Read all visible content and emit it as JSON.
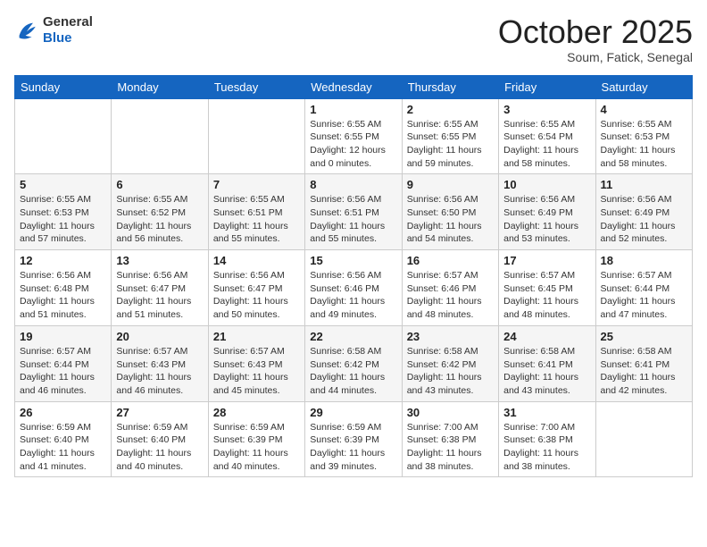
{
  "header": {
    "logo_general": "General",
    "logo_blue": "Blue",
    "month_title": "October 2025",
    "location": "Soum, Fatick, Senegal"
  },
  "columns": [
    "Sunday",
    "Monday",
    "Tuesday",
    "Wednesday",
    "Thursday",
    "Friday",
    "Saturday"
  ],
  "weeks": [
    [
      {
        "day": "",
        "info": ""
      },
      {
        "day": "",
        "info": ""
      },
      {
        "day": "",
        "info": ""
      },
      {
        "day": "1",
        "info": "Sunrise: 6:55 AM\nSunset: 6:55 PM\nDaylight: 12 hours\nand 0 minutes."
      },
      {
        "day": "2",
        "info": "Sunrise: 6:55 AM\nSunset: 6:55 PM\nDaylight: 11 hours\nand 59 minutes."
      },
      {
        "day": "3",
        "info": "Sunrise: 6:55 AM\nSunset: 6:54 PM\nDaylight: 11 hours\nand 58 minutes."
      },
      {
        "day": "4",
        "info": "Sunrise: 6:55 AM\nSunset: 6:53 PM\nDaylight: 11 hours\nand 58 minutes."
      }
    ],
    [
      {
        "day": "5",
        "info": "Sunrise: 6:55 AM\nSunset: 6:53 PM\nDaylight: 11 hours\nand 57 minutes."
      },
      {
        "day": "6",
        "info": "Sunrise: 6:55 AM\nSunset: 6:52 PM\nDaylight: 11 hours\nand 56 minutes."
      },
      {
        "day": "7",
        "info": "Sunrise: 6:55 AM\nSunset: 6:51 PM\nDaylight: 11 hours\nand 55 minutes."
      },
      {
        "day": "8",
        "info": "Sunrise: 6:56 AM\nSunset: 6:51 PM\nDaylight: 11 hours\nand 55 minutes."
      },
      {
        "day": "9",
        "info": "Sunrise: 6:56 AM\nSunset: 6:50 PM\nDaylight: 11 hours\nand 54 minutes."
      },
      {
        "day": "10",
        "info": "Sunrise: 6:56 AM\nSunset: 6:49 PM\nDaylight: 11 hours\nand 53 minutes."
      },
      {
        "day": "11",
        "info": "Sunrise: 6:56 AM\nSunset: 6:49 PM\nDaylight: 11 hours\nand 52 minutes."
      }
    ],
    [
      {
        "day": "12",
        "info": "Sunrise: 6:56 AM\nSunset: 6:48 PM\nDaylight: 11 hours\nand 51 minutes."
      },
      {
        "day": "13",
        "info": "Sunrise: 6:56 AM\nSunset: 6:47 PM\nDaylight: 11 hours\nand 51 minutes."
      },
      {
        "day": "14",
        "info": "Sunrise: 6:56 AM\nSunset: 6:47 PM\nDaylight: 11 hours\nand 50 minutes."
      },
      {
        "day": "15",
        "info": "Sunrise: 6:56 AM\nSunset: 6:46 PM\nDaylight: 11 hours\nand 49 minutes."
      },
      {
        "day": "16",
        "info": "Sunrise: 6:57 AM\nSunset: 6:46 PM\nDaylight: 11 hours\nand 48 minutes."
      },
      {
        "day": "17",
        "info": "Sunrise: 6:57 AM\nSunset: 6:45 PM\nDaylight: 11 hours\nand 48 minutes."
      },
      {
        "day": "18",
        "info": "Sunrise: 6:57 AM\nSunset: 6:44 PM\nDaylight: 11 hours\nand 47 minutes."
      }
    ],
    [
      {
        "day": "19",
        "info": "Sunrise: 6:57 AM\nSunset: 6:44 PM\nDaylight: 11 hours\nand 46 minutes."
      },
      {
        "day": "20",
        "info": "Sunrise: 6:57 AM\nSunset: 6:43 PM\nDaylight: 11 hours\nand 46 minutes."
      },
      {
        "day": "21",
        "info": "Sunrise: 6:57 AM\nSunset: 6:43 PM\nDaylight: 11 hours\nand 45 minutes."
      },
      {
        "day": "22",
        "info": "Sunrise: 6:58 AM\nSunset: 6:42 PM\nDaylight: 11 hours\nand 44 minutes."
      },
      {
        "day": "23",
        "info": "Sunrise: 6:58 AM\nSunset: 6:42 PM\nDaylight: 11 hours\nand 43 minutes."
      },
      {
        "day": "24",
        "info": "Sunrise: 6:58 AM\nSunset: 6:41 PM\nDaylight: 11 hours\nand 43 minutes."
      },
      {
        "day": "25",
        "info": "Sunrise: 6:58 AM\nSunset: 6:41 PM\nDaylight: 11 hours\nand 42 minutes."
      }
    ],
    [
      {
        "day": "26",
        "info": "Sunrise: 6:59 AM\nSunset: 6:40 PM\nDaylight: 11 hours\nand 41 minutes."
      },
      {
        "day": "27",
        "info": "Sunrise: 6:59 AM\nSunset: 6:40 PM\nDaylight: 11 hours\nand 40 minutes."
      },
      {
        "day": "28",
        "info": "Sunrise: 6:59 AM\nSunset: 6:39 PM\nDaylight: 11 hours\nand 40 minutes."
      },
      {
        "day": "29",
        "info": "Sunrise: 6:59 AM\nSunset: 6:39 PM\nDaylight: 11 hours\nand 39 minutes."
      },
      {
        "day": "30",
        "info": "Sunrise: 7:00 AM\nSunset: 6:38 PM\nDaylight: 11 hours\nand 38 minutes."
      },
      {
        "day": "31",
        "info": "Sunrise: 7:00 AM\nSunset: 6:38 PM\nDaylight: 11 hours\nand 38 minutes."
      },
      {
        "day": "",
        "info": ""
      }
    ]
  ]
}
